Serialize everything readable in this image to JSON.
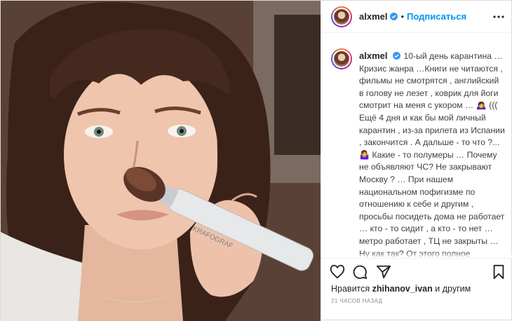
{
  "post": {
    "username": "alxmel",
    "follow_label": "Подписаться",
    "separator": "•",
    "caption": "10-ый день карантина … Кризис жанра …Книги не читаются , фильмы не смотрятся , английский в голову не лезет , коврик для йоги смотрит на меня с укором … 🙇‍♀️ ((( Ещё 4 дня и как бы мой личный карантин , из-за прилета из Испании , закончится . А дальше - то что ?... 🤷‍♀️ Какие - то полумеры … Почему не объявляют ЧС? Не закрывают Москву ? … При нашем национальном пофигизме по отношению к себе и другим , просьбы посидеть дома не работает … кто - то сидит , а кто - то нет … метро работает , ТЦ не закрыты … Ну как так? От этого полное непонимание , сколько это ещё будет длиться, и что будет когда это закончится … Я знаю , что остается",
    "likes_prefix": "Нравится ",
    "likes_user": "zhihanov_ivan",
    "likes_suffix": " и другим",
    "timestamp": "21 часов назад"
  },
  "photo": {
    "brush_text": "KRAFOGRAF"
  },
  "icons": {
    "more": "more-options-icon",
    "like": "heart-icon",
    "comment": "comment-icon",
    "share": "share-icon",
    "save": "bookmark-icon",
    "verified": "verified-badge-icon"
  },
  "colors": {
    "accent": "#0095f6",
    "text": "#262626",
    "muted": "#8e8e8e",
    "border": "#dbdbdb"
  }
}
